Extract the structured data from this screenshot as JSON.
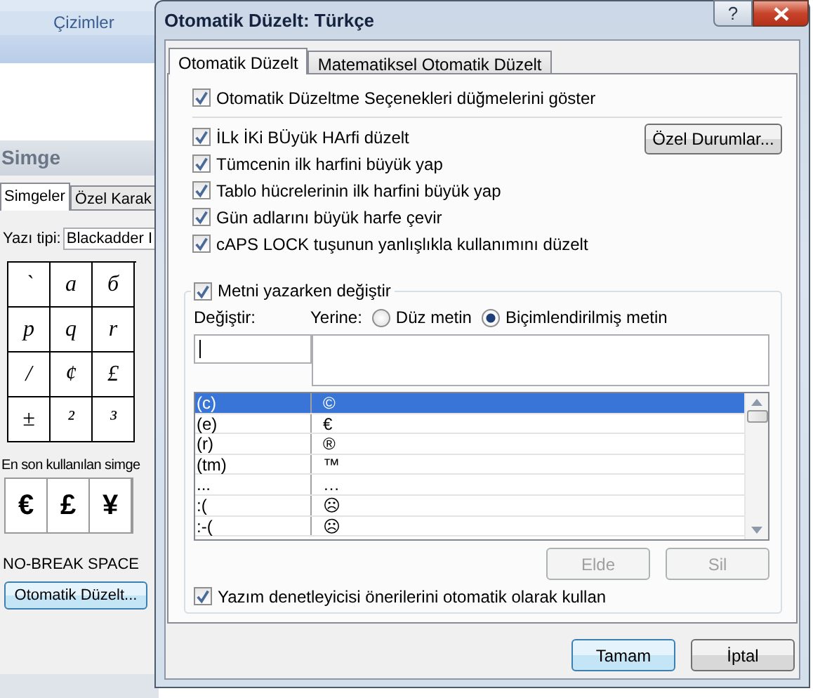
{
  "background_window": {
    "ribbon_group": "Çizimler",
    "dialog_title": "Simge",
    "tabs": [
      {
        "label": "Simgeler",
        "selected": true
      },
      {
        "label": "Özel Karak",
        "selected": false
      }
    ],
    "font_label": "Yazı tipi:",
    "font_value": "Blackadder I",
    "symbols": [
      [
        "`",
        "a",
        "б"
      ],
      [
        "p",
        "q",
        "r"
      ],
      [
        "/",
        "¢",
        "£"
      ],
      [
        "±",
        "²",
        "³"
      ]
    ],
    "recent_label": "En son kullanılan simge",
    "recent_symbols": [
      "€",
      "£",
      "¥"
    ],
    "character_name": "NO-BREAK SPACE",
    "autocorrect_button": "Otomatik Düzelt..."
  },
  "dialog": {
    "title": "Otomatik Düzelt: Türkçe",
    "help_button": "?",
    "tabs": [
      {
        "label": "Otomatik Düzelt",
        "selected": true
      },
      {
        "label": "Matematiksel Otomatik Düzelt",
        "selected": false
      }
    ],
    "top_option": {
      "label": "Otomatik Düzeltme Seçenekleri düğmelerini göster",
      "checked": true
    },
    "options": [
      {
        "label": "İLk İKi BÜyük HArfi düzelt",
        "checked": true
      },
      {
        "label": "Tümcenin ilk harfini büyük yap",
        "checked": true
      },
      {
        "label": "Tablo hücrelerinin ilk harfini büyük yap",
        "checked": true
      },
      {
        "label": "Gün adlarını büyük harfe çevir",
        "checked": true
      },
      {
        "label": "cAPS LOCK tuşunun yanlışlıkla kullanımını düzelt",
        "checked": true
      }
    ],
    "exceptions_button": "Özel Durumlar...",
    "replace_group": {
      "label": "Metni yazarken değiştir",
      "checked": true,
      "replace_label": "Değiştir:",
      "with_label": "Yerine:",
      "formats": [
        {
          "label": "Düz metin",
          "selected": false
        },
        {
          "label": "Biçimlendirilmiş metin",
          "selected": true
        }
      ],
      "entries": [
        {
          "replace": "(c)",
          "with": "©",
          "selected": true
        },
        {
          "replace": "(e)",
          "with": "€",
          "selected": false
        },
        {
          "replace": "(r)",
          "with": "®",
          "selected": false
        },
        {
          "replace": "(tm)",
          "with": "™",
          "selected": false
        },
        {
          "replace": "...",
          "with": "…",
          "selected": false
        },
        {
          "replace": ":(",
          "with": "☹",
          "selected": false
        },
        {
          "replace": ":-(",
          "with": "☹",
          "selected": false
        }
      ],
      "buttons": [
        {
          "label": "Elde",
          "disabled": true
        },
        {
          "label": "Sil",
          "disabled": true
        }
      ]
    },
    "spell_option": {
      "label": "Yazım denetleyicisi önerilerini otomatik olarak kullan",
      "checked": true
    },
    "buttons": [
      {
        "label": "Tamam",
        "default": true
      },
      {
        "label": "İptal",
        "default": false
      }
    ]
  }
}
